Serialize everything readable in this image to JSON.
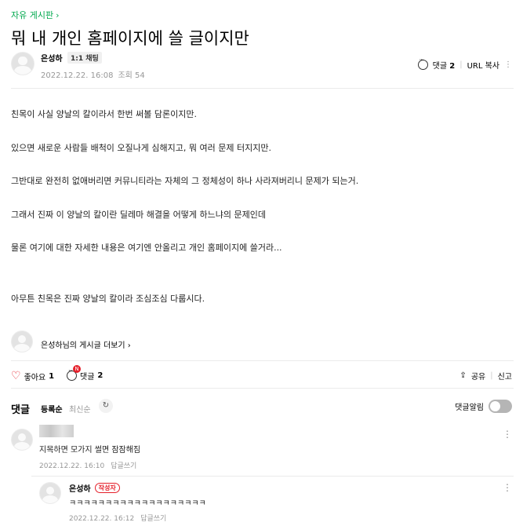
{
  "post": {
    "category": "자유 게시판",
    "title": "뭐 내 개인 홈페이지에 쓸 글이지만",
    "author": "은성하",
    "badge": "1:1 채팅",
    "date": "2022.12.22. 16:08",
    "views": "조회 54",
    "comment_label": "댓글",
    "comment_count": "2",
    "url_copy": "URL 복사",
    "paragraphs": [
      "친목이 사실 양날의 칼이라서 한번 써볼 담론이지만.",
      "있으면 새로운 사람들 배척이 오질나게 심해지고, 뭐 여러 문제 터지지만.",
      "그반대로 완전히 없애버리면 커뮤니티라는 자체의 그 정체성이 하나 사라져버리니 문제가 되는거.",
      "그래서 진짜 이 양날의 칼이란 딜레마 해결을 어떻게 하느냐의 문제인데",
      "물론 여기에 대한 자세한 내용은 여기엔 안올리고 개인 홈페이지에 쓸거라...",
      "아무튼 친목은 진짜 양날의 칼이라 조심조심 다룹시다."
    ],
    "profile_link": "은성하님의 게시글 더보기"
  },
  "actions": {
    "like_label": "좋아요",
    "like_count": "1",
    "comment_label": "댓글",
    "comment_count": "2",
    "notif_badge": "N",
    "share": "공유",
    "report": "신고"
  },
  "comments_section": {
    "title": "댓글",
    "sort_registered": "등록순",
    "sort_latest": "최신순",
    "refresh_icon": "↻",
    "alarm_label": "댓글알림"
  },
  "comments": [
    {
      "text": "지목하면 모가지 썰면 잠잠해짐",
      "date": "2022.12.22. 16:10",
      "reply_label": "답글쓰기"
    },
    {
      "author": "은성하",
      "writer_badge": "작성자",
      "text": "ㅋㅋㅋㅋㅋㅋㅋㅋㅋㅋㅋㅋㅋㅋㅋㅋㅋㅋㅋ",
      "date": "2022.12.22. 16:12",
      "reply_label": "답글쓰기"
    }
  ],
  "colors": {
    "accent_green": "#03a94f",
    "red": "#e5202b"
  }
}
